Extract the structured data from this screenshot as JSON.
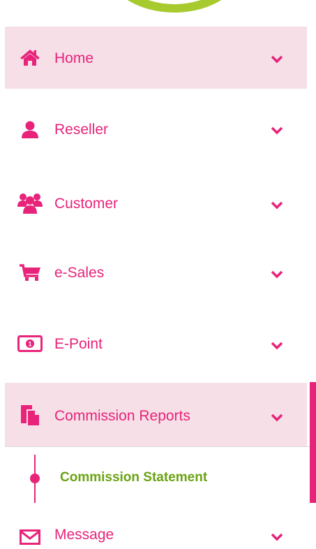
{
  "sidebar": {
    "items": [
      {
        "label": "Home",
        "icon": "home-icon"
      },
      {
        "label": "Reseller",
        "icon": "user-icon"
      },
      {
        "label": "Customer",
        "icon": "users-icon"
      },
      {
        "label": "e-Sales",
        "icon": "cart-icon"
      },
      {
        "label": "E-Point",
        "icon": "money-icon"
      },
      {
        "label": "Commission Reports",
        "icon": "report-icon"
      },
      {
        "label": "Message",
        "icon": "envelope-icon"
      }
    ],
    "submenu": {
      "label": "Commission Statement"
    }
  },
  "colors": {
    "accent": "#e8237a",
    "active_background": "#f6dfe7",
    "submenu_text": "#6aa313",
    "logo": "#a7cb2f"
  }
}
